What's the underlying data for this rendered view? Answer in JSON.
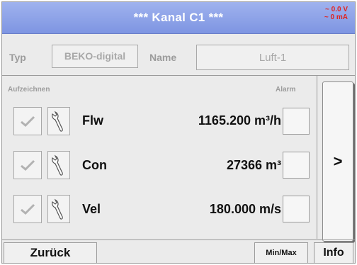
{
  "header": {
    "title": "*** Kanal C1 ***",
    "status_voltage": "~ 0.0 V",
    "status_current": "~ 0 mA"
  },
  "config": {
    "type_label": "Typ",
    "type_value": "BEKO-digital",
    "name_label": "Name",
    "name_value": "Luft-1"
  },
  "channels": {
    "record_header": "Aufzeichnen",
    "alarm_header": "Alarm",
    "rows": [
      {
        "name": "Flw",
        "value": "1165.200 m³/h"
      },
      {
        "name": "Con",
        "value": "27366 m³"
      },
      {
        "name": "Vel",
        "value": "180.000 m/s"
      }
    ]
  },
  "side_button": {
    "label": ">"
  },
  "footer": {
    "back_label": "Zurück",
    "minmax_label": "Min/Max",
    "info_label": "Info"
  },
  "icons": {
    "check": "check-icon",
    "tool": "wrench-icon"
  },
  "colors": {
    "titlebar": "#8aa0e8",
    "status_text": "#e0241f",
    "panel_bg": "#ebebeb"
  }
}
